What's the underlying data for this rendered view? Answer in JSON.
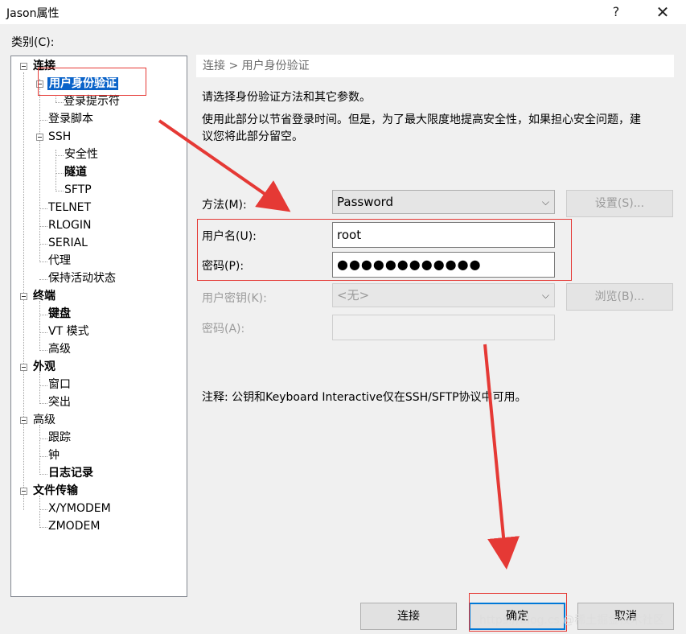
{
  "window": {
    "title": "Jason属性",
    "help_label": "?",
    "close_label": "✕"
  },
  "category_label": "类别(C):",
  "tree": {
    "items": [
      {
        "label": "连接",
        "bold": true
      },
      {
        "label": "用户身份验证",
        "bold": true,
        "selected": true
      },
      {
        "label": "登录提示符"
      },
      {
        "label": "登录脚本"
      },
      {
        "label": "SSH"
      },
      {
        "label": "安全性"
      },
      {
        "label": "隧道",
        "bold": true
      },
      {
        "label": "SFTP"
      },
      {
        "label": "TELNET"
      },
      {
        "label": "RLOGIN"
      },
      {
        "label": "SERIAL"
      },
      {
        "label": "代理"
      },
      {
        "label": "保持活动状态"
      },
      {
        "label": "终端",
        "bold": true
      },
      {
        "label": "键盘",
        "bold": true
      },
      {
        "label": "VT 模式"
      },
      {
        "label": "高级"
      },
      {
        "label": "外观",
        "bold": true
      },
      {
        "label": "窗口"
      },
      {
        "label": "突出"
      },
      {
        "label": "高级"
      },
      {
        "label": "跟踪"
      },
      {
        "label": "钟"
      },
      {
        "label": "日志记录",
        "bold": true
      },
      {
        "label": "文件传输",
        "bold": true
      },
      {
        "label": "X/YMODEM"
      },
      {
        "label": "ZMODEM"
      }
    ]
  },
  "breadcrumb": "连接 > 用户身份验证",
  "intro": "请选择身份验证方法和其它参数。",
  "hint": {
    "line1": "使用此部分以节省登录时间。但是，为了最大限度地提高安全性，如果担心安全问题，建",
    "line2": "议您将此部分留空。"
  },
  "form": {
    "method_label": "方法(M):",
    "method_value": "Password",
    "settings_button": "设置(S)...",
    "username_label": "用户名(U):",
    "username_value": "root",
    "password_label": "密码(P):",
    "password_value": "●●●●●●●●●●●●",
    "user_key_label": "用户密钥(K):",
    "user_key_value": "<无>",
    "browse_button": "浏览(B)...",
    "passphrase_label": "密码(A):",
    "passphrase_value": ""
  },
  "note": "注释: 公钥和Keyboard Interactive仅在SSH/SFTP协议中可用。",
  "buttons": {
    "connect": "连接",
    "ok": "确定",
    "cancel": "取消"
  },
  "icons": {
    "chevron": "⌵"
  },
  "watermark": "https://blog.cs @稀土掘金技术社区",
  "colors": {
    "selection": "#0a63c9",
    "annotation_red": "#e53935",
    "default_button_border": "#0078d7"
  }
}
